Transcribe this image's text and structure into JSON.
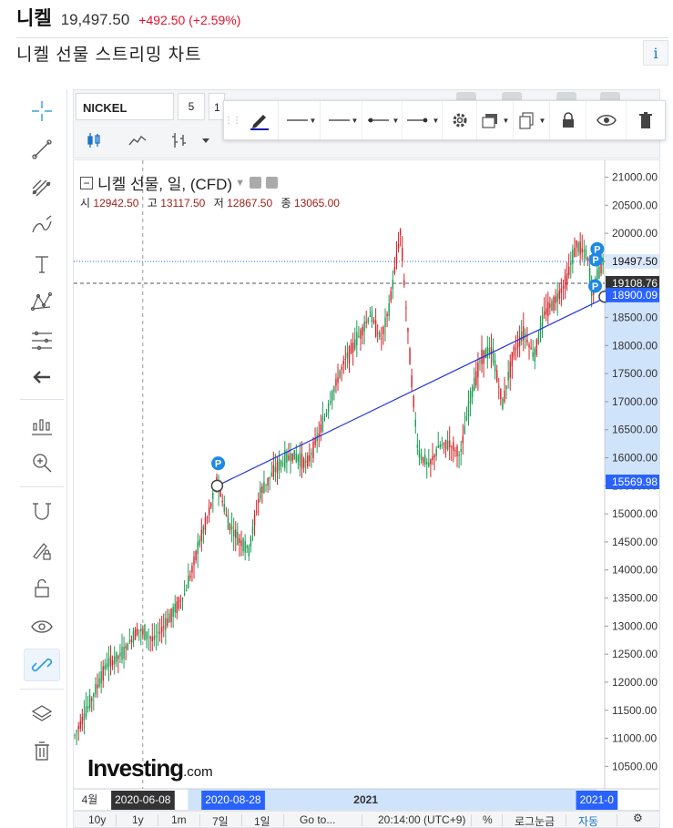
{
  "header": {
    "name": "니켈",
    "price": "19,497.50",
    "change": "+492.50 (+2.59%)",
    "subtitle": "니켈 선물 스트리밍 차트",
    "info_icon": "i"
  },
  "toolbar": {
    "symbol": "NICKEL",
    "interval": "5",
    "interval2": "1",
    "draw_color": "#1a1aa8"
  },
  "left_tools": [
    "crosshair-icon",
    "trendline-icon",
    "fib-icon",
    "brush-icon",
    "text-icon",
    "pattern-icon",
    "measure-icon",
    "back-arrow-icon",
    "indicator-icon",
    "zoom-in-icon",
    "magnet-icon",
    "lock-draw-icon",
    "unlock-icon",
    "eye-icon",
    "link-icon",
    "layers-icon",
    "trash-icon"
  ],
  "legend": {
    "title": "니켈 선물, 일, (CFD)",
    "o_label": "시",
    "o": "12942.50",
    "h_label": "고",
    "h": "13117.50",
    "l_label": "저",
    "l": "12867.50",
    "c_label": "종",
    "c": "13065.00"
  },
  "logo": {
    "main": "Investing",
    "suffix": ".com"
  },
  "bottom": {
    "b10y": "10y",
    "b1y": "1y",
    "b1m": "1m",
    "b7d": "7일",
    "b1d": "1일",
    "goto": "Go to...",
    "time": "20:14:00 (UTC+9)",
    "pct": "%",
    "log": "로그눈금",
    "auto": "자동"
  },
  "chart_data": {
    "type": "candlestick",
    "title": "니켈 선물, 일, (CFD)",
    "ylim": [
      10100,
      21300
    ],
    "y_ticks": [
      10500,
      11000,
      11500,
      12000,
      12500,
      13000,
      13500,
      14000,
      14500,
      15000,
      15500,
      16000,
      16500,
      17000,
      17500,
      18000,
      18500,
      19000,
      19500,
      20000,
      20500,
      21000
    ],
    "y_tick_labels": [
      "10500.00",
      "11000.00",
      "11500.00",
      "12000.00",
      "12500.00",
      "13000.00",
      "13500.00",
      "14000.00",
      "14500.00",
      "15000.00",
      "15500.00",
      "16000.00",
      "16500.00",
      "17000.00",
      "17500.00",
      "18000.00",
      "18500.00",
      "19000.00",
      "19500.00",
      "20000.00",
      "20500.00",
      "21000.00"
    ],
    "x_ticks": [
      {
        "label": "4월",
        "pos": 0.03
      },
      {
        "label": "2020-06-08",
        "pos": 0.13,
        "highlight": "dark"
      },
      {
        "label": "2020-08-28",
        "pos": 0.3,
        "highlight": "blue"
      },
      {
        "label": "2021",
        "pos": 0.55
      },
      {
        "label": "2021-0",
        "pos": 0.985,
        "highlight": "blue"
      }
    ],
    "price_series": [
      [
        0.0,
        11050
      ],
      [
        0.03,
        11650
      ],
      [
        0.06,
        12300
      ],
      [
        0.09,
        12500
      ],
      [
        0.12,
        12950
      ],
      [
        0.15,
        12750
      ],
      [
        0.18,
        13150
      ],
      [
        0.21,
        13600
      ],
      [
        0.235,
        14450
      ],
      [
        0.255,
        15050
      ],
      [
        0.27,
        15600
      ],
      [
        0.29,
        14850
      ],
      [
        0.31,
        14550
      ],
      [
        0.33,
        14350
      ],
      [
        0.35,
        15350
      ],
      [
        0.38,
        15800
      ],
      [
        0.41,
        16050
      ],
      [
        0.44,
        15900
      ],
      [
        0.47,
        16600
      ],
      [
        0.49,
        17200
      ],
      [
        0.51,
        17700
      ],
      [
        0.54,
        18200
      ],
      [
        0.56,
        18550
      ],
      [
        0.58,
        18100
      ],
      [
        0.595,
        18650
      ],
      [
        0.61,
        19600
      ],
      [
        0.617,
        20050
      ],
      [
        0.625,
        18950
      ],
      [
        0.64,
        17150
      ],
      [
        0.65,
        16100
      ],
      [
        0.67,
        15850
      ],
      [
        0.69,
        16200
      ],
      [
        0.71,
        16250
      ],
      [
        0.73,
        16050
      ],
      [
        0.75,
        17100
      ],
      [
        0.77,
        17800
      ],
      [
        0.79,
        17900
      ],
      [
        0.81,
        16950
      ],
      [
        0.83,
        17850
      ],
      [
        0.85,
        18250
      ],
      [
        0.87,
        17800
      ],
      [
        0.89,
        18600
      ],
      [
        0.91,
        18800
      ],
      [
        0.93,
        19150
      ],
      [
        0.95,
        19800
      ],
      [
        0.97,
        19600
      ],
      [
        0.98,
        18900
      ],
      [
        0.99,
        19250
      ],
      [
        1.0,
        19500
      ]
    ],
    "trendline": {
      "from": [
        0.27,
        15500
      ],
      "to": [
        1.005,
        18870
      ]
    },
    "hlines": [
      {
        "value": 19497.5,
        "label": "19497.50",
        "style": "dotted",
        "color": "#2962ff"
      },
      {
        "value": 19108.76,
        "label": "19108.76",
        "style": "dashed",
        "color": "#555555"
      },
      {
        "value": 18900.09,
        "label": "18900.09",
        "style": "solid",
        "color": "#2962ff"
      },
      {
        "value": 15569.98,
        "label": "15569.98",
        "style": "solid",
        "color": "#2962ff"
      }
    ],
    "crosshair_x": 0.13,
    "markers": [
      {
        "label": "P",
        "pos": [
          0.272,
          15900
        ]
      },
      {
        "label": "P",
        "pos": [
          0.986,
          19720
        ]
      },
      {
        "label": "P",
        "pos": [
          0.983,
          19530
        ]
      },
      {
        "label": "P",
        "pos": [
          0.982,
          19060
        ]
      }
    ],
    "axis_selection": {
      "y_from": 15569.98,
      "y_to": 18900.09,
      "x_from": 0.215,
      "x_to": 0.985
    }
  }
}
